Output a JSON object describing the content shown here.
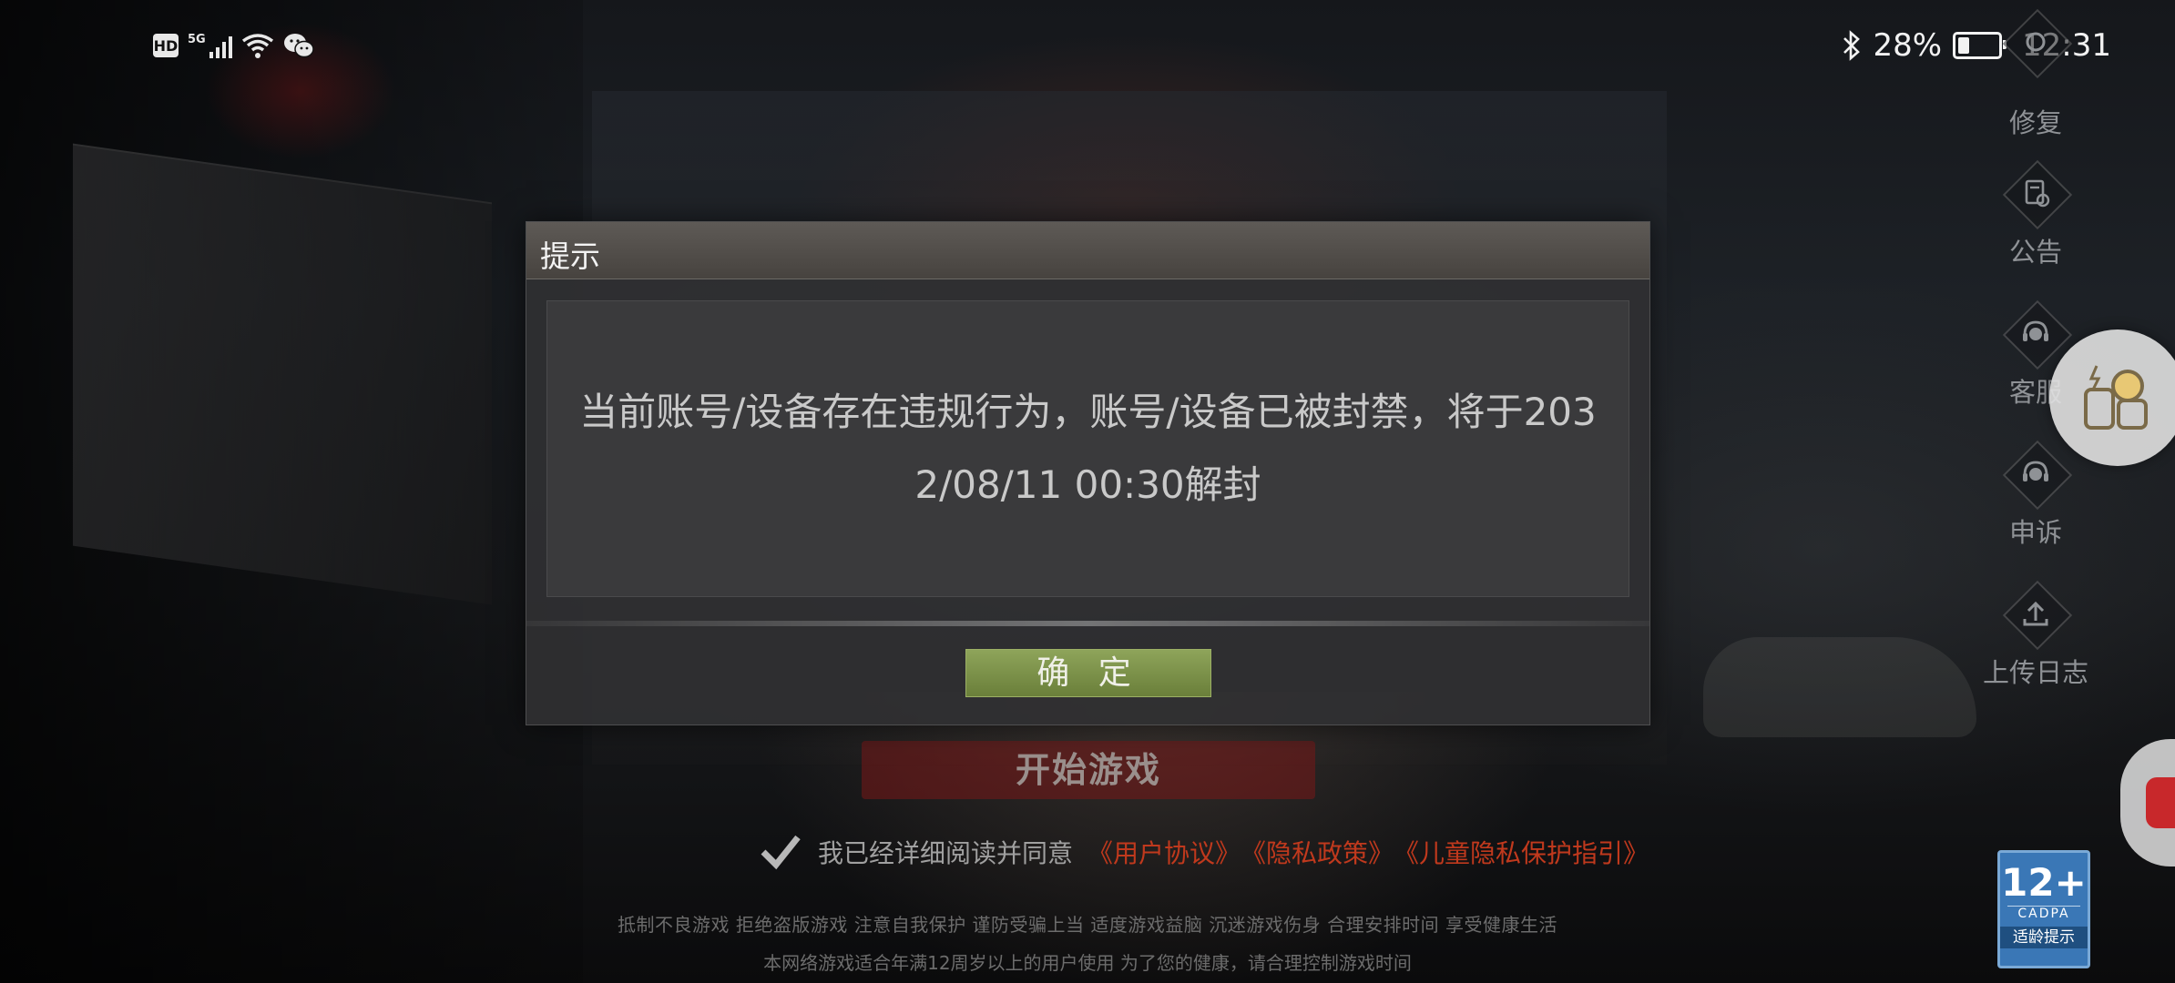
{
  "status_bar": {
    "left_badges": [
      "HD",
      "5G"
    ],
    "battery": "28%",
    "battery_level": 0.28,
    "time": "12:31",
    "icons": [
      "hd-icon",
      "signal-5g-icon",
      "wifi-icon",
      "wechat-icon",
      "bluetooth-icon",
      "battery-icon"
    ]
  },
  "side_menu": {
    "items": [
      {
        "label": "修复",
        "icon": "repair-gear-icon"
      },
      {
        "label": "公告",
        "icon": "announcement-icon"
      },
      {
        "label": "客服",
        "icon": "customer-service-icon"
      },
      {
        "label": "申诉",
        "icon": "appeal-headset-icon"
      },
      {
        "label": "上传日志",
        "icon": "upload-log-icon"
      }
    ]
  },
  "dialog": {
    "title": "提示",
    "message_line1": "当前账号/设备存在违规行为，账号/设备已被封禁，将于203",
    "message_line2": "2/08/11 00:30解封",
    "ok_label": "确 定",
    "ok_color": "#7c9148"
  },
  "main": {
    "start_button": "开始游戏",
    "agree_checked": true,
    "agree_text": "我已经详细阅读并同意",
    "agree_links": [
      "《用户协议》",
      "《隐私政策》",
      "《儿童隐私保护指引》"
    ],
    "link_color": "#c0391d",
    "notice_line1": "抵制不良游戏 拒绝盗版游戏 注意自我保护 谨防受骗上当 适度游戏益脑 沉迷游戏伤身 合理安排时间 享受健康生活",
    "notice_line2": "本网络游戏适合年满12周岁以上的用户使用    为了您的健康，请合理控制游戏时间"
  },
  "age_rating": {
    "number": "12+",
    "org": "CADPA",
    "label": "适龄提示"
  }
}
